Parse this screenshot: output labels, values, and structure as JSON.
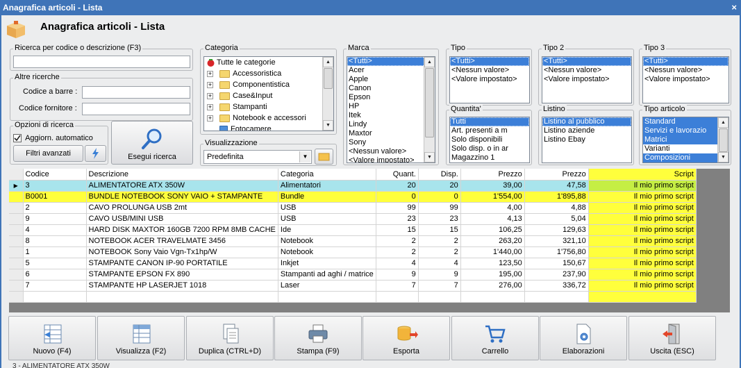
{
  "window": {
    "title": "Anagrafica articoli  - Lista",
    "close": "×"
  },
  "header": {
    "title": "Anagrafica articoli  - Lista",
    "icon": "box-icon"
  },
  "search": {
    "group_label": "Ricerca per codice o descrizione (F3)",
    "value": "",
    "other_label": "Altre ricerche",
    "barcode_label": "Codice a barre :",
    "supplier_code_label": "Codice fornitore :",
    "options_label": "Opzioni di ricerca",
    "auto_update_label": "Aggiorn. automatico",
    "auto_update_checked": true,
    "advanced_filters_label": "Filtri avanzati",
    "run_label": "Esegui ricerca"
  },
  "categoria": {
    "label": "Categoria",
    "items": [
      "Tutte le categorie",
      "Accessoristica",
      "Componentistica",
      "Case&Input",
      "Stampanti",
      "Notebook e accessori",
      "Fotocamere"
    ]
  },
  "visualizzazione": {
    "label": "Visualizzazione",
    "value": "Predefinita"
  },
  "marca": {
    "label": "Marca",
    "items": [
      "<Tutti>",
      "Acer",
      "Apple",
      "Canon",
      "Epson",
      "HP",
      "Itek",
      "Lindy",
      "Maxtor",
      "Sony",
      "<Nessun valore>",
      "<Valore impostato>"
    ]
  },
  "tipo": {
    "label": "Tipo",
    "items": [
      "<Tutti>",
      "<Nessun valore>",
      "<Valore impostato>"
    ]
  },
  "tipo2": {
    "label": "Tipo 2",
    "items": [
      "<Tutti>",
      "<Nessun valore>",
      "<Valore impostato>"
    ]
  },
  "tipo3": {
    "label": "Tipo 3",
    "items": [
      "<Tutti>",
      "<Nessun valore>",
      "<Valore impostato>"
    ]
  },
  "quantita": {
    "label": "Quantita'",
    "items": [
      "Tutti",
      "Art. presenti a m",
      "Solo disponibili",
      "Solo disp. o in ar",
      "Magazzino 1"
    ]
  },
  "listino": {
    "label": "Listino",
    "items": [
      "Listino al pubblico",
      "Listino aziende",
      "Listino Ebay"
    ]
  },
  "tipo_articolo": {
    "label": "Tipo articolo",
    "items": [
      "Standard",
      "Servizi e lavorazio",
      "Matrici",
      "Varianti",
      "Composizioni"
    ]
  },
  "table": {
    "columns": [
      "Codice",
      "Descrizione",
      "Categoria",
      "Quant.",
      "Disp.",
      "Prezzo",
      "Prezzo",
      "Script"
    ],
    "rows": [
      [
        "3",
        "ALIMENTATORE ATX 350W",
        "Alimentatori",
        "20",
        "20",
        "39,00",
        "47,58",
        "Il mio primo script"
      ],
      [
        "B0001",
        "BUNDLE NOTEBOOK SONY VAIO + STAMPANTE",
        "Bundle",
        "0",
        "0",
        "1'554,00",
        "1'895,88",
        "Il mio primo script"
      ],
      [
        "2",
        "CAVO PROLUNGA USB 2mt",
        "USB",
        "99",
        "99",
        "4,00",
        "4,88",
        "Il mio primo script"
      ],
      [
        "9",
        "CAVO USB/MINI USB",
        "USB",
        "23",
        "23",
        "4,13",
        "5,04",
        "Il mio primo script"
      ],
      [
        "4",
        "HARD DISK MAXTOR 160GB 7200 RPM 8MB CACHE",
        "Ide",
        "15",
        "15",
        "106,25",
        "129,63",
        "Il mio primo script"
      ],
      [
        "8",
        "NOTEBOOK ACER TRAVELMATE 3456",
        "Notebook",
        "2",
        "2",
        "263,20",
        "321,10",
        "Il mio primo script"
      ],
      [
        "1",
        "NOTEBOOK Sony Vaio Vgn-Tx1hp/W",
        "Notebook",
        "2",
        "2",
        "1'440,00",
        "1'756,80",
        "Il mio primo script"
      ],
      [
        "5",
        "STAMPANTE CANON IP-90 PORTATILE",
        "Inkjet",
        "4",
        "4",
        "123,50",
        "150,67",
        "Il mio primo script"
      ],
      [
        "6",
        "STAMPANTE EPSON FX 890",
        "Stampanti ad aghi / matrice",
        "9",
        "9",
        "195,00",
        "237,90",
        "Il mio primo script"
      ],
      [
        "7",
        "STAMPANTE HP LASERJET 1018",
        "Laser",
        "7",
        "7",
        "276,00",
        "336,72",
        "Il mio primo script"
      ]
    ]
  },
  "toolbar": {
    "buttons": [
      "Nuovo (F4)",
      "Visualizza (F2)",
      "Duplica (CTRL+D)",
      "Stampa (F9)",
      "Esporta",
      "Carrello",
      "Elaborazioni",
      "Uscita (ESC)"
    ]
  },
  "status": {
    "text": "3 - ALIMENTATORE ATX 350W"
  }
}
